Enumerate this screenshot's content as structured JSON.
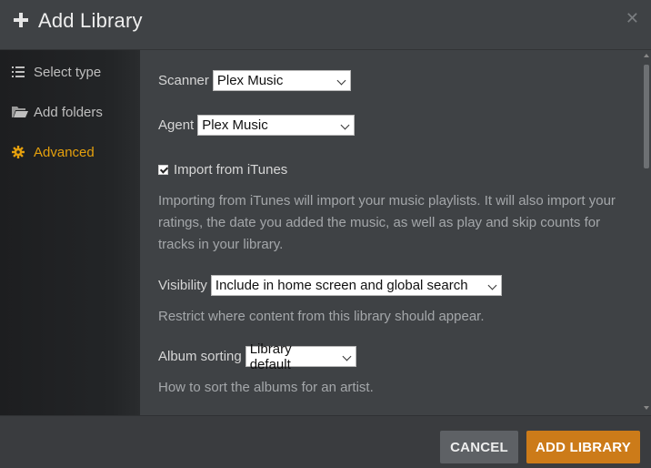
{
  "dialog": {
    "title": "Add Library"
  },
  "sidebar": {
    "items": [
      {
        "label": "Select type",
        "icon": "list-icon"
      },
      {
        "label": "Add folders",
        "icon": "folder-icon"
      },
      {
        "label": "Advanced",
        "icon": "gear-icon",
        "active": true
      }
    ]
  },
  "form": {
    "scanner": {
      "label": "Scanner",
      "value": "Plex Music"
    },
    "agent": {
      "label": "Agent",
      "value": "Plex Music"
    },
    "itunes": {
      "label": "Import from iTunes",
      "checked": true,
      "help": "Importing from iTunes will import your music playlists. It will also import your ratings, the date you added the music, as well as play and skip counts for tracks in your library."
    },
    "visibility": {
      "label": "Visibility",
      "value": "Include in home screen and global search",
      "help": "Restrict where content from this library should appear."
    },
    "album_sorting": {
      "label": "Album sorting",
      "value": "Library default",
      "help": "How to sort the albums for an artist."
    }
  },
  "footer": {
    "cancel_label": "CANCEL",
    "add_label": "ADD LIBRARY"
  },
  "colors": {
    "accent": "#e5a00d",
    "primary_button": "#cc7b19",
    "background": "#3f4245"
  }
}
